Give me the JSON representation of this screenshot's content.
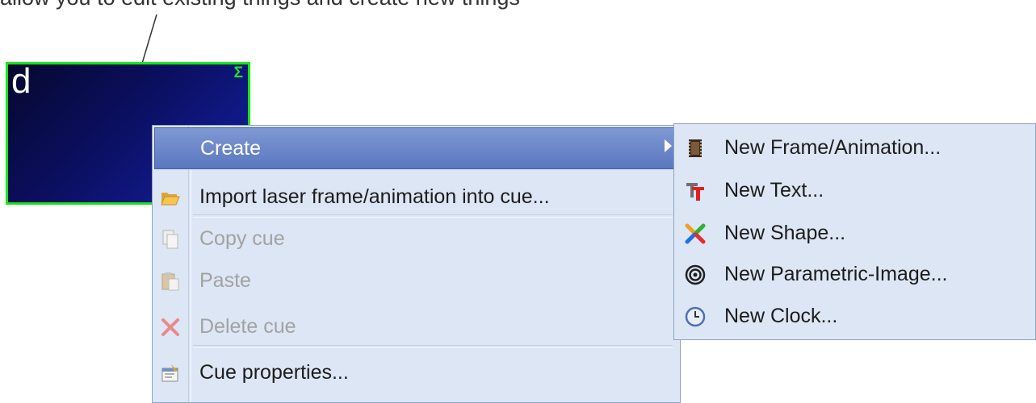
{
  "caption": "allow you to edit existing things and create new things",
  "cue": {
    "letter": "d",
    "badge": "Σ"
  },
  "context_menu": {
    "items": [
      {
        "label": "Create",
        "icon": "none",
        "enabled": true,
        "highlighted": true,
        "has_submenu": true
      },
      {
        "label": "Import laser frame/animation into cue...",
        "icon": "folder-open-icon",
        "enabled": true
      },
      {
        "label": "Copy cue",
        "icon": "copy-icon",
        "enabled": false
      },
      {
        "label": "Paste",
        "icon": "paste-icon",
        "enabled": false
      },
      {
        "label": "Delete cue",
        "icon": "delete-x-icon",
        "enabled": false
      },
      {
        "label": "Cue properties...",
        "icon": "properties-icon",
        "enabled": true
      }
    ]
  },
  "submenu": {
    "items": [
      {
        "label": "New Frame/Animation...",
        "icon": "film-frame-icon"
      },
      {
        "label": "New Text...",
        "icon": "text-tool-icon"
      },
      {
        "label": "New Shape...",
        "icon": "shape-tool-icon"
      },
      {
        "label": "New Parametric-Image...",
        "icon": "spiral-icon"
      },
      {
        "label": "New Clock...",
        "icon": "clock-icon"
      }
    ]
  },
  "colors": {
    "menu_bg": "#dce6f4",
    "highlight": "#6a86c9",
    "cue_border": "#17e617",
    "cue_bg": "#0b0f60"
  }
}
